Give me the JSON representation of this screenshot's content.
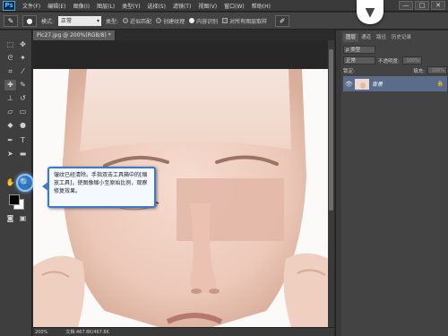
{
  "app": {
    "logo": "Ps"
  },
  "menu": [
    "文件(F)",
    "编辑(E)",
    "图像(I)",
    "图层(L)",
    "类型(Y)",
    "选择(S)",
    "滤镜(T)",
    "视图(V)",
    "窗口(W)",
    "帮助(H)"
  ],
  "window_controls": [
    "—",
    "□",
    "✕"
  ],
  "options_bar": {
    "mode_label": "模式:",
    "mode_value": "正常",
    "type_label": "类型:",
    "type_options": [
      "近似匹配",
      "创建纹理",
      "内容识别"
    ],
    "type_selected": 2,
    "sample_all_label": "对所有图层取样"
  },
  "document": {
    "tab_title": "Pic27.jpg @ 200%(RGB/8) *",
    "zoom": "200%",
    "doc_size": "文档:467.8K/467.8K"
  },
  "callout": {
    "text": "皱纹已经清除。手指双击工具箱中的[缩放工具]，使图像缩小至原始比例，观察修复效果。"
  },
  "layers_panel": {
    "tabs": [
      "图层",
      "通道",
      "路径",
      "历史记录"
    ],
    "filter_label": "ρ 类型",
    "blend_mode": "正常",
    "opacity_label": "不透明度:",
    "opacity_value": "100%",
    "lock_label": "锁定:",
    "fill_label": "填充:",
    "fill_value": "100%",
    "layer_name": "背景"
  },
  "colors": {
    "accent": "#3c7ad0",
    "highlight": "#2d78c8",
    "layer_selected": "#5a6c8a"
  }
}
